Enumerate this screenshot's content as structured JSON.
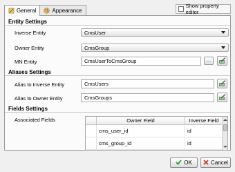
{
  "tabs": [
    {
      "label": "General",
      "icon": "wrench-icon",
      "active": true
    },
    {
      "label": "Appearance",
      "icon": "palette-icon",
      "active": false
    }
  ],
  "show_property_editor": {
    "label": "Show property editor",
    "checked": false
  },
  "entity_settings": {
    "title": "Entity Settings",
    "inverse_entity": {
      "label": "Inverse Entity",
      "value": "CmsUser"
    },
    "owner_entity": {
      "label": "Owner Entity",
      "value": "CmsGroup"
    },
    "mn_entity": {
      "label": "MN Entity",
      "value": "CmsUserToCmsGroup",
      "browse_label": "..."
    }
  },
  "aliases_settings": {
    "title": "Aliases Settings",
    "alias_inverse": {
      "label": "Alias to Inverse Entity",
      "value": "CmsUsers"
    },
    "alias_owner": {
      "label": "Alias to Owner Entity",
      "value": "CmsGroups"
    }
  },
  "fields_settings": {
    "title": "Fields Settings",
    "associated_label": "Associated Fields",
    "columns": [
      "",
      "Owner Field",
      "Inverse Field"
    ],
    "rows": [
      {
        "owner": "cms_user_id",
        "inverse": "id"
      },
      {
        "owner": "cms_group_id",
        "inverse": "id"
      }
    ]
  },
  "buttons": {
    "ok": "OK",
    "cancel": "Cancel"
  },
  "colors": {
    "ok_check": "#2e9a2e",
    "cancel_x": "#c0392b",
    "edit_icon": "#3c7a3c"
  }
}
